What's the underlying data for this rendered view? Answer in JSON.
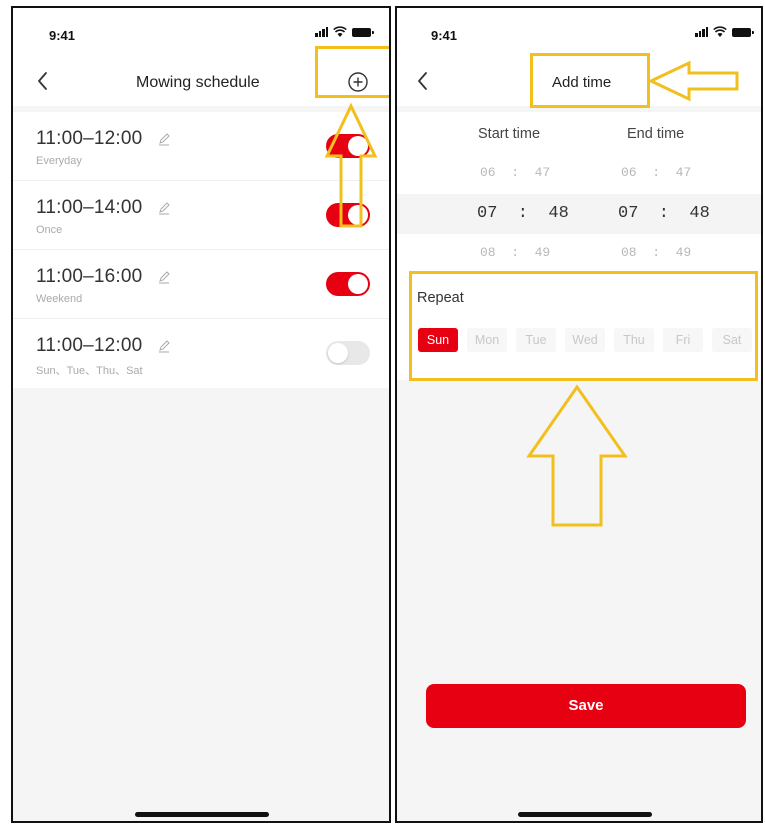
{
  "schedule_screen": {
    "status_time": "9:41",
    "title": "Mowing schedule",
    "items": [
      {
        "time": "11:00–12:00",
        "repeat": "Everyday",
        "enabled": true
      },
      {
        "time": "11:00–14:00",
        "repeat": "Once",
        "enabled": true
      },
      {
        "time": "11:00–16:00",
        "repeat": "Weekend",
        "enabled": true
      },
      {
        "time": "11:00–12:00",
        "repeat": "Sun、Tue、Thu、Sat",
        "enabled": false
      }
    ]
  },
  "add_screen": {
    "status_time": "9:41",
    "title": "Add time",
    "start_label": "Start time",
    "end_label": "End time",
    "start_rows": [
      "06  :  47",
      "07  :  48",
      "08  :  49"
    ],
    "end_rows": [
      "06  :  47",
      "07  :  48",
      "08  :  49"
    ],
    "repeat_label": "Repeat",
    "days": [
      {
        "label": "Sun",
        "selected": true
      },
      {
        "label": "Mon",
        "selected": false
      },
      {
        "label": "Tue",
        "selected": false
      },
      {
        "label": "Wed",
        "selected": false
      },
      {
        "label": "Thu",
        "selected": false
      },
      {
        "label": "Fri",
        "selected": false
      },
      {
        "label": "Sat",
        "selected": false
      }
    ],
    "save_label": "Save"
  },
  "colors": {
    "accent": "#e60012",
    "highlight": "#f2c01e",
    "toggle_off": "#e8e8e8"
  },
  "icons": {
    "back": "chevron-left-icon",
    "add": "plus-circle-icon",
    "edit": "pencil-icon"
  }
}
